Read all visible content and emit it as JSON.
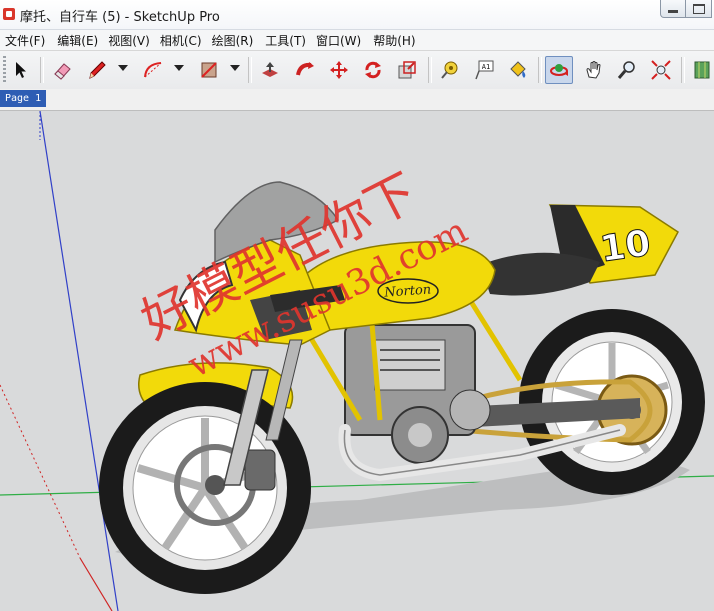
{
  "window": {
    "title": "摩托、自行车 (5) - SketchUp Pro"
  },
  "menu": {
    "items": [
      "文件(F)",
      "编辑(E)",
      "视图(V)",
      "相机(C)",
      "绘图(R)",
      "工具(T)",
      "窗口(W)",
      "帮助(H)"
    ]
  },
  "toolbar": {
    "text_tool_glyph": "A1",
    "tools": [
      "select-arrow-icon",
      "eraser-icon",
      "pencil-icon",
      "arc-icon",
      "rectangle-icon",
      "push-pull-icon",
      "follow-me-icon",
      "move-icon",
      "rotate-icon",
      "scale-icon",
      "tape-measure-icon",
      "text-icon",
      "paint-bucket-icon",
      "orbit-icon",
      "pan-icon",
      "zoom-icon",
      "zoom-extents-icon",
      "map-icon"
    ],
    "active_tool": "orbit-icon"
  },
  "scenes": {
    "tabs": [
      "Page 1"
    ]
  },
  "model": {
    "race_number": "10",
    "tank_logo": "Norton"
  },
  "watermark": {
    "line1": "好模型任你下",
    "line2": "www.susu3d.com"
  },
  "colors": {
    "body_yellow": "#f2da0a",
    "scene_tab": "#2e5db4",
    "viewport_bg": "#d9dadb",
    "watermark_red": "#e0352e"
  }
}
